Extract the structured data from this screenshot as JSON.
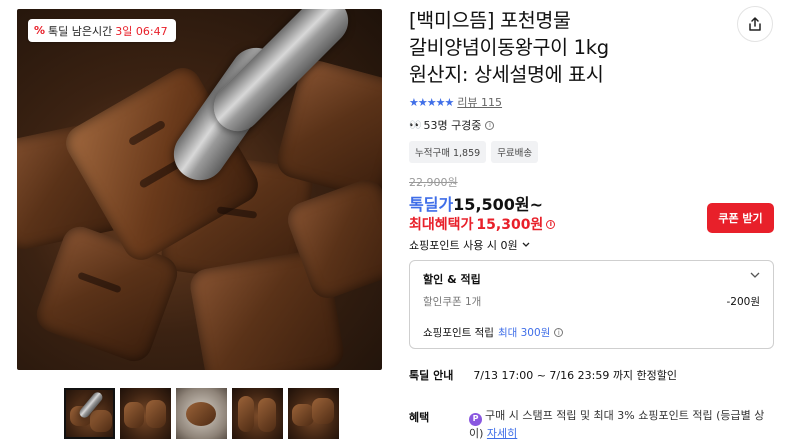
{
  "timer": {
    "label": "톡딜 남은시간",
    "value": "3일 06:47",
    "icon": "discount-icon"
  },
  "product": {
    "title_lines": [
      "[백미으뜸] 포천명물",
      "갈비양념이동왕구이 1kg",
      "원산지: 상세설명에 표시"
    ],
    "rating_stars": "★★★★★",
    "rating_value": 5,
    "review_label": "리뷰 115",
    "viewers": "53명 구경중",
    "tags": [
      "누적구매 1,859",
      "무료배송"
    ]
  },
  "price": {
    "original": "22,900원",
    "deal_label": "톡딜가",
    "deal_amount": "15,500원~",
    "max_benefit_label": "최대혜택가",
    "max_benefit_amount": "15,300원",
    "coupon_button": "쿠폰 받기",
    "point_use": "쇼핑포인트 사용 시 0원"
  },
  "discount": {
    "title": "할인 & 적립",
    "coupon_label": "할인쿠폰 1개",
    "coupon_value": "-200원",
    "point_label": "쇼핑포인트 적립",
    "point_max": "최대 300원"
  },
  "deal_notice": {
    "label": "톡딜 안내",
    "text": "7/13 17:00 ~ 7/16 23:59 까지 한정할인"
  },
  "benefit": {
    "label": "혜택",
    "text": "구매 시 스탬프 적립 및 최대 3% 쇼핑포인트 적립 (등급별 상이)",
    "link": "자세히"
  },
  "colors": {
    "accent_blue": "#3f6ee8",
    "accent_red": "#e8202a"
  },
  "icons": {
    "share": "share-icon",
    "chevron": "chevron-down-icon",
    "info": "info-icon",
    "pay": "pay-point-icon"
  }
}
